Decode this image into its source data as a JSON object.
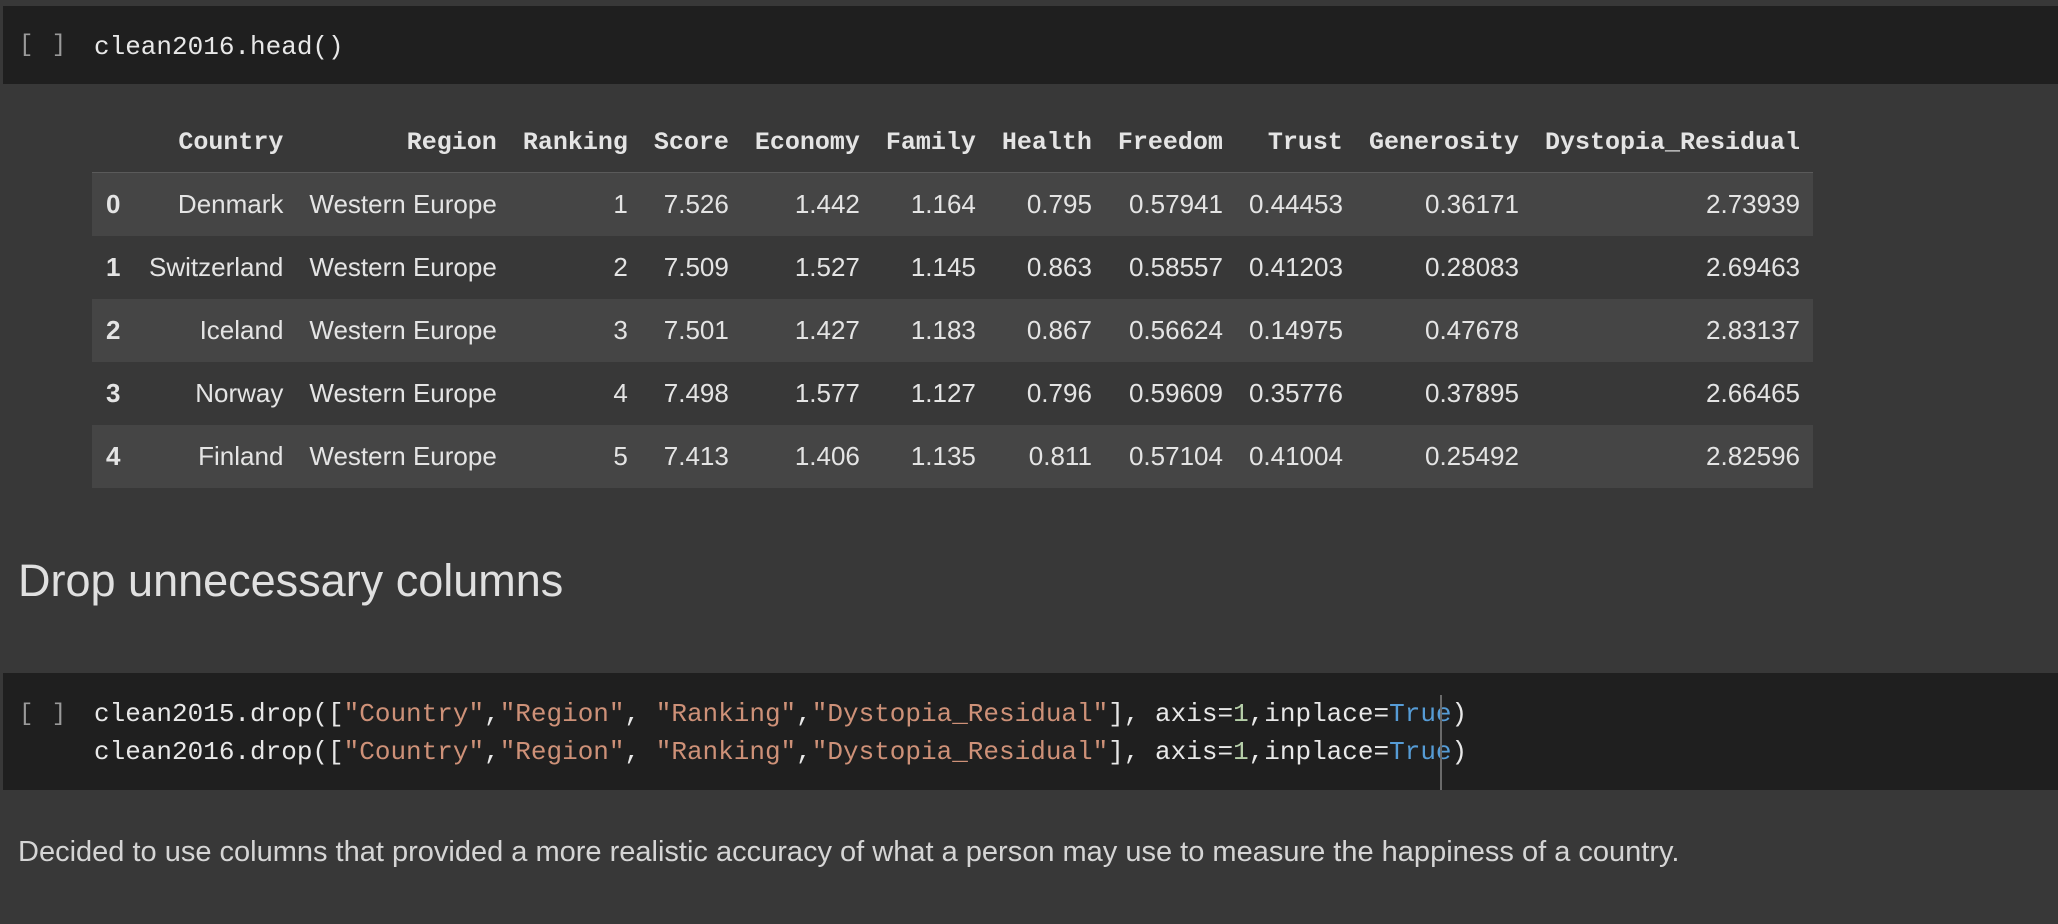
{
  "cell1": {
    "run_bracket": "[ ]",
    "code": "clean2016.head()"
  },
  "table": {
    "columns": [
      "",
      "Country",
      "Region",
      "Ranking",
      "Score",
      "Economy",
      "Family",
      "Health",
      "Freedom",
      "Trust",
      "Generosity",
      "Dystopia_Residual"
    ],
    "rows": [
      [
        "0",
        "Denmark",
        "Western Europe",
        "1",
        "7.526",
        "1.442",
        "1.164",
        "0.795",
        "0.57941",
        "0.44453",
        "0.36171",
        "2.73939"
      ],
      [
        "1",
        "Switzerland",
        "Western Europe",
        "2",
        "7.509",
        "1.527",
        "1.145",
        "0.863",
        "0.58557",
        "0.41203",
        "0.28083",
        "2.69463"
      ],
      [
        "2",
        "Iceland",
        "Western Europe",
        "3",
        "7.501",
        "1.427",
        "1.183",
        "0.867",
        "0.56624",
        "0.14975",
        "0.47678",
        "2.83137"
      ],
      [
        "3",
        "Norway",
        "Western Europe",
        "4",
        "7.498",
        "1.577",
        "1.127",
        "0.796",
        "0.59609",
        "0.35776",
        "0.37895",
        "2.66465"
      ],
      [
        "4",
        "Finland",
        "Western Europe",
        "5",
        "7.413",
        "1.406",
        "1.135",
        "0.811",
        "0.57104",
        "0.41004",
        "0.25492",
        "2.82596"
      ]
    ]
  },
  "heading": "Drop unnecessary columns",
  "cell2": {
    "run_bracket": "[ ]",
    "line1": {
      "p1": "clean2015.drop([",
      "s1": "\"Country\"",
      "c1": ",",
      "s2": "\"Region\"",
      "c2": ", ",
      "s3": "\"Ranking\"",
      "c3": ",",
      "s4": "\"Dystopia_Residual\"",
      "p2": "], axis=",
      "n1": "1",
      "p3": ",inplace=",
      "k1": "True",
      "p4": ")"
    },
    "line2": {
      "p1": "clean2016.drop([",
      "s1": "\"Country\"",
      "c1": ",",
      "s2": "\"Region\"",
      "c2": ", ",
      "s3": "\"Ranking\"",
      "c3": ",",
      "s4": "\"Dystopia_Residual\"",
      "p2": "], axis=",
      "n1": "1",
      "p3": ",inplace=",
      "k1": "True",
      "p4": ")"
    }
  },
  "description": "Decided to use columns that provided a more realistic accuracy of what a person may use to measure the happiness of a country.",
  "colors": {
    "background": "#383838",
    "code_cell": "#1f1f1f",
    "string": "#ce9178",
    "number": "#b5cea8",
    "keyword": "#569cd6"
  }
}
